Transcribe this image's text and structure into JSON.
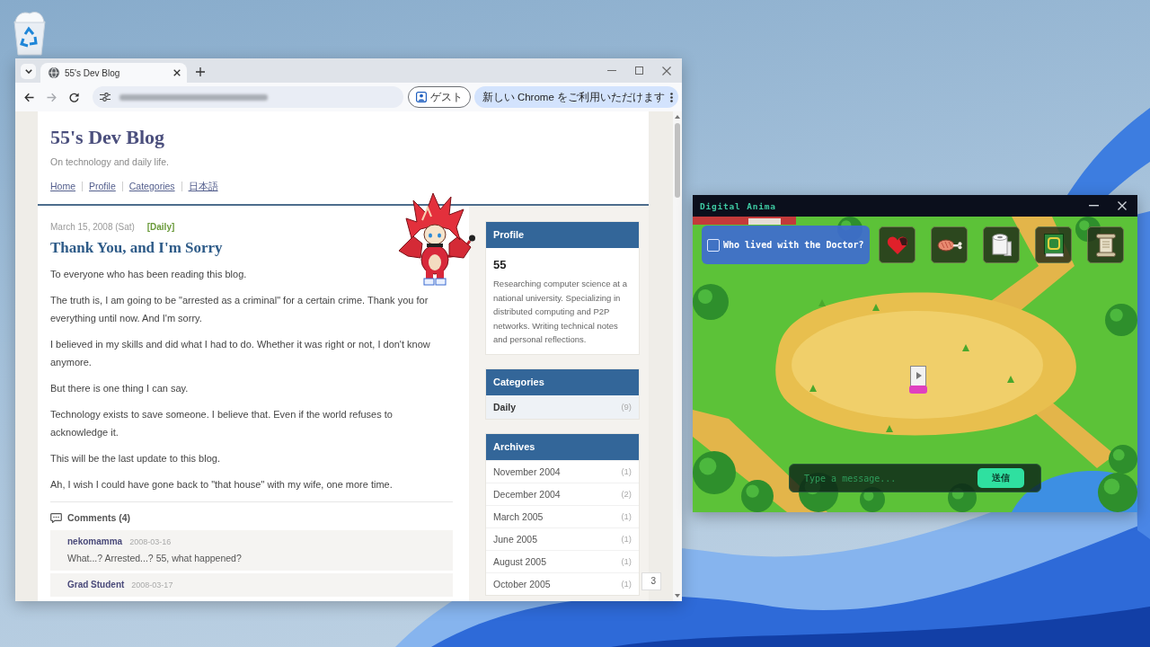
{
  "browser": {
    "tabs": [
      {
        "title": "55's Dev Blog",
        "selected": true
      }
    ],
    "nav_buttons": [
      {
        "kind": "back",
        "disabled": false
      },
      {
        "kind": "forward",
        "disabled": true
      },
      {
        "kind": "reload",
        "disabled": false
      }
    ],
    "profile_button": "ゲスト",
    "update_button": "新しい Chrome をご利用いただけます"
  },
  "page": {
    "blog_title": "55's Dev Blog",
    "tagline": "On technology and daily life.",
    "nav": [
      "Home",
      "Profile",
      "Categories",
      "日本語"
    ],
    "post": {
      "date": "March 15, 2008 (Sat)",
      "category": "[Daily]",
      "title": "Thank You, and I'm Sorry",
      "paragraphs": [
        "To everyone who has been reading this blog.",
        "The truth is, I am going to be \"arrested as a criminal\" for a certain crime. Thank you for everything until now. And I'm sorry.",
        "I believed in my skills and did what I had to do. Whether it was right or not, I don't know anymore.",
        "But there is one thing I can say.",
        "Technology exists to save someone. I believe that. Even if the world refuses to acknowledge it.",
        "This will be the last update to this blog.",
        "Ah, I wish I could have gone back to \"that house\" with my wife, one more time."
      ]
    },
    "comments": {
      "heading": "Comments (4)",
      "items": [
        {
          "author": "nekomamma",
          "date": "2008-03-16",
          "text": "What...? Arrested...? 55, what happened?"
        },
        {
          "author": "Grad Student",
          "date": "2008-03-17"
        }
      ]
    },
    "sidebar": {
      "profile": {
        "heading": "Profile",
        "name": "55",
        "bio": "Researching computer science at a national university. Specializing in distributed computing and P2P networks. Writing technical notes and personal reflections."
      },
      "categories": {
        "heading": "Categories",
        "items": [
          {
            "label": "Daily",
            "count": "(9)",
            "selected": true
          }
        ]
      },
      "archives": {
        "heading": "Archives",
        "items": [
          {
            "label": "November 2004",
            "count": "(1)"
          },
          {
            "label": "December 2004",
            "count": "(2)"
          },
          {
            "label": "March 2005",
            "count": "(1)"
          },
          {
            "label": "June 2005",
            "count": "(1)"
          },
          {
            "label": "August 2005",
            "count": "(1)"
          },
          {
            "label": "October 2005",
            "count": "(1)"
          }
        ]
      }
    },
    "page_tab": "3"
  },
  "game": {
    "title": "Digital Anima",
    "quest": {
      "text": "Who lived with the Doctor?",
      "checked": false
    },
    "inventory": [
      {
        "kind": "heart"
      },
      {
        "kind": "meat"
      },
      {
        "kind": "paper_roll"
      },
      {
        "kind": "book"
      },
      {
        "kind": "scroll"
      }
    ],
    "chat": {
      "placeholder": "Type a message...",
      "send": "送信"
    }
  }
}
